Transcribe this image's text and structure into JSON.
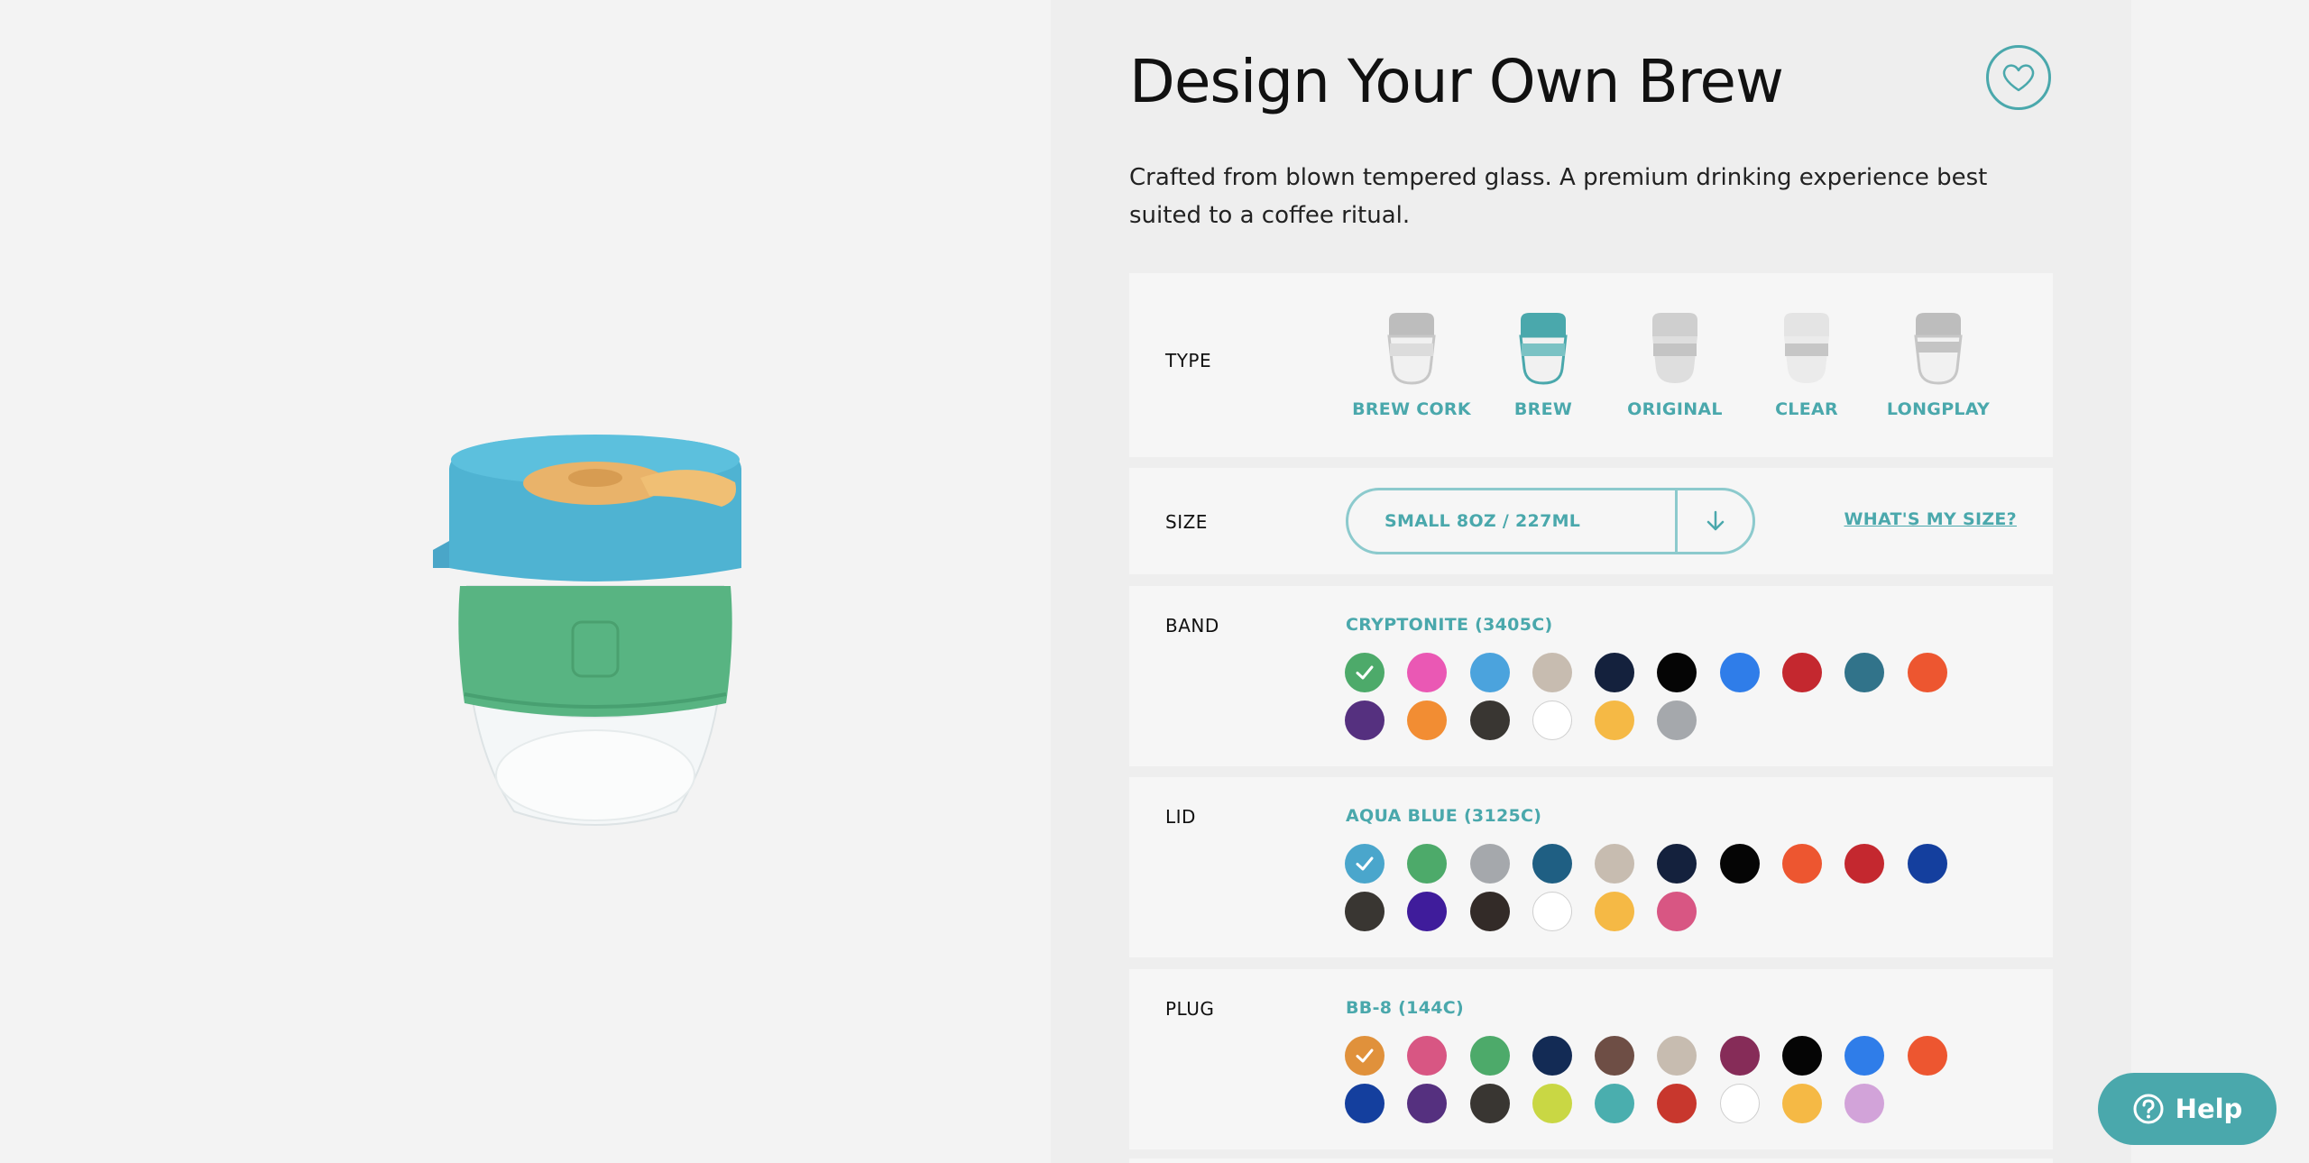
{
  "product": {
    "title": "Design Your Own Brew",
    "description": "Crafted from blown tempered glass. A premium drinking experience best suited to a coffee ritual."
  },
  "type": {
    "label": "TYPE",
    "options": [
      {
        "label": "BREW CORK",
        "selected": false
      },
      {
        "label": "BREW",
        "selected": true
      },
      {
        "label": "ORIGINAL",
        "selected": false
      },
      {
        "label": "CLEAR",
        "selected": false
      },
      {
        "label": "LONGPLAY",
        "selected": false
      }
    ]
  },
  "size": {
    "label": "SIZE",
    "selected": "SMALL 8OZ / 227ML",
    "help_link": "WHAT'S MY SIZE?"
  },
  "band": {
    "label": "BAND",
    "selected_name": "CRYPTONITE (3405C)",
    "colors": [
      "#4daa6a",
      "#ea58b4",
      "#4ba3dd",
      "#c7bcb0",
      "#14213d",
      "#050505",
      "#2f7de9",
      "#c4282f",
      "#31738a",
      "#ed5630",
      "#55307f",
      "#f28d33",
      "#393632",
      "#ffffff",
      "#f5b945",
      "#a5a8ac"
    ],
    "selected_index": 0
  },
  "lid": {
    "label": "LID",
    "selected_name": "AQUA BLUE (3125C)",
    "colors": [
      "#4aa6cc",
      "#4daa6a",
      "#a5a8ac",
      "#1f5f83",
      "#c7bcb0",
      "#14213d",
      "#050505",
      "#ed5630",
      "#c4282f",
      "#143f9e",
      "#393632",
      "#3f1c9b",
      "#332b28",
      "#ffffff",
      "#f5b945",
      "#d85683"
    ],
    "selected_index": 0
  },
  "plug": {
    "label": "PLUG",
    "selected_name": "BB-8 (144C)",
    "colors": [
      "#e0913b",
      "#d85683",
      "#4daa6a",
      "#132b55",
      "#6e4e45",
      "#c7bcb0",
      "#862c58",
      "#050505",
      "#2f7de9",
      "#ed5630",
      "#143f9e",
      "#55307f",
      "#393632",
      "#c9d744",
      "#4aaeae",
      "#c8372d",
      "#ffffff",
      "#f5b945",
      "#d2a3d9"
    ],
    "selected_index": 0
  },
  "help": {
    "label": "Help"
  },
  "colors": {
    "accent": "#4aa8ac",
    "accent_light": "#8ccacd"
  }
}
